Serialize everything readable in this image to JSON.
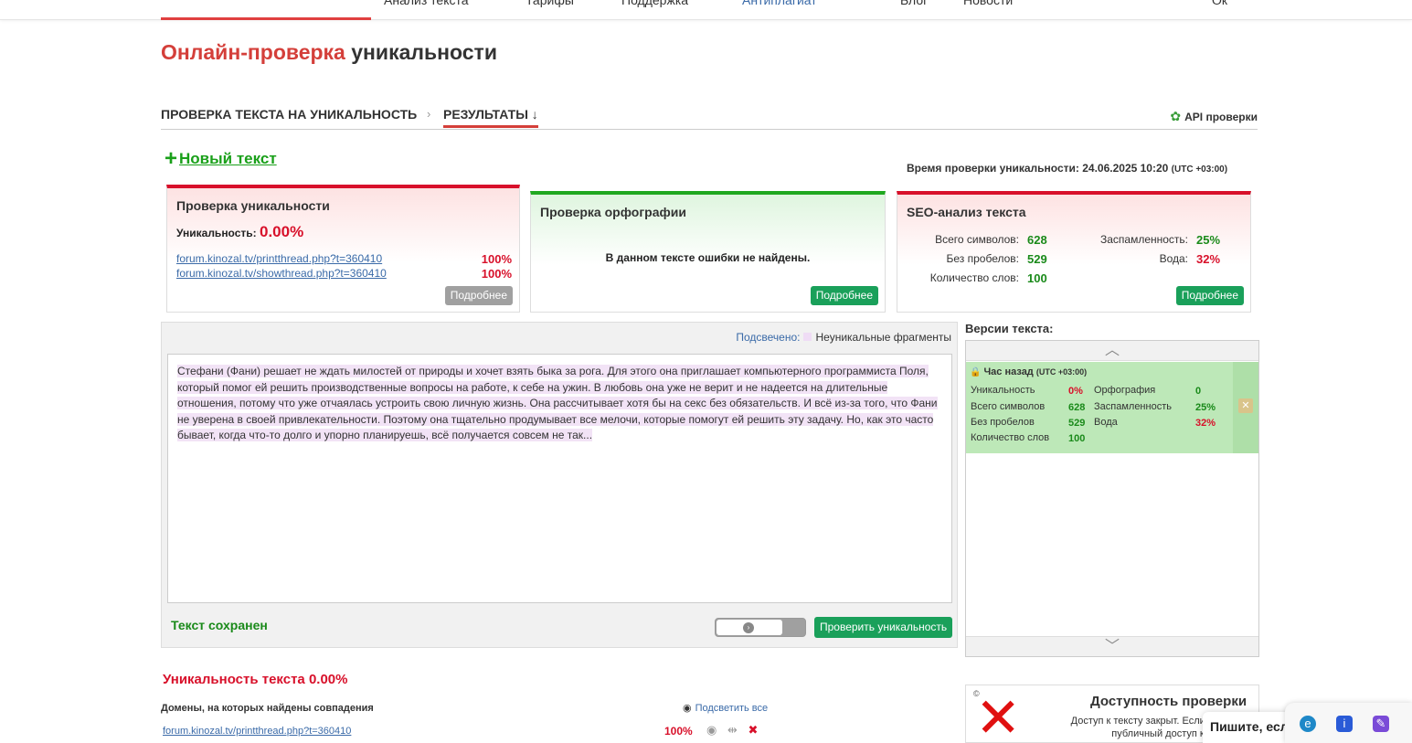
{
  "nav": {
    "items": [
      "Анализ текста",
      "Тарифы",
      "Поддержка",
      "Антиплагиат",
      "Блог",
      "Новости",
      "Ок"
    ]
  },
  "page": {
    "title_red": "Онлайн-проверка",
    "title_dark": "уникальности"
  },
  "breadcrumb": {
    "step1": "ПРОВЕРКА ТЕКСТА НА УНИКАЛЬНОСТЬ",
    "sep": "›",
    "step2": "РЕЗУЛЬТАТЫ ↓",
    "api": "API проверки"
  },
  "new_text": {
    "plus": "+",
    "label": "Новый текст"
  },
  "check_time": {
    "label": "Время проверки уникальности: 24.06.2025 10:20",
    "tz": "(UTC +03:00)"
  },
  "cards": {
    "uniqueness": {
      "title": "Проверка уникальности",
      "label": "Уникальность:",
      "value": "0.00%",
      "sources": [
        {
          "url": "forum.kinozal.tv/printthread.php?t=360410",
          "pct": "100%"
        },
        {
          "url": "forum.kinozal.tv/showthread.php?t=360410",
          "pct": "100%"
        }
      ],
      "more": "Подробнее"
    },
    "spelling": {
      "title": "Проверка орфографии",
      "message": "В данном тексте ошибки не найдены.",
      "more": "Подробнее"
    },
    "seo": {
      "title": "SEO-анализ текста",
      "total_chars_label": "Всего символов:",
      "total_chars": "628",
      "no_spaces_label": "Без пробелов:",
      "no_spaces": "529",
      "words_label": "Количество слов:",
      "words": "100",
      "spam_label": "Заспамленность:",
      "spam": "25%",
      "water_label": "Вода:",
      "water": "32%",
      "more": "Подробнее"
    }
  },
  "editor": {
    "highlight_label": "Подсвечено:",
    "highlight_legend": "Неуникальные фрагменты",
    "text": "Стефани (Фани) решает не ждать милостей от природы и хочет взять быка за рога. Для этого она приглашает компьютерного программиста Поля, который помог ей решить производственные вопросы на работе, к себе на ужин. В любовь она уже не верит и не надеется на длительные отношения, потому что уже отчаялась устроить свою личную жизнь. Она рассчитывает хотя бы на секс без обязательств. И всё из-за того, что Фани не уверена в своей привлекательности. Поэтому она тщательно продумывает все мелочи, которые помогут ей решить эту задачу. Но, как это часто бывает, когда что-то долго и упорно планируешь, всё получается совсем не так...",
    "saved": "Текст сохранен",
    "check_button": "Проверить уникальность"
  },
  "versions": {
    "title": "Версии текста:",
    "item": {
      "when": "Час назад",
      "tz": "(UTC +03:00)",
      "uniq_label": "Уникальность",
      "uniq": "0%",
      "spell_label": "Орфография",
      "spell": "0",
      "chars_label": "Всего символов",
      "chars": "628",
      "spam_label": "Заспамленность",
      "spam": "25%",
      "nospace_label": "Без пробелов",
      "nospace": "529",
      "water_label": "Вода",
      "water": "32%",
      "words_label": "Количество слов",
      "words": "100"
    }
  },
  "results": {
    "uniq_title": "Уникальность текста 0.00%",
    "domains_title": "Домены, на которых найдены совпадения",
    "highlight_all": "Подсветить все",
    "rows": [
      {
        "url": "forum.kinozal.tv/printthread.php?t=360410",
        "pct": "100%"
      }
    ]
  },
  "availability": {
    "title": "Доступность проверки",
    "text": "Доступ к тексту закрыт. Если открыть публичный доступ к"
  },
  "write_popup": "Пишите, если",
  "colors": {
    "accent_red": "#d8102a",
    "accent_green": "#1aa05a",
    "link_blue": "#3a6aa8"
  }
}
